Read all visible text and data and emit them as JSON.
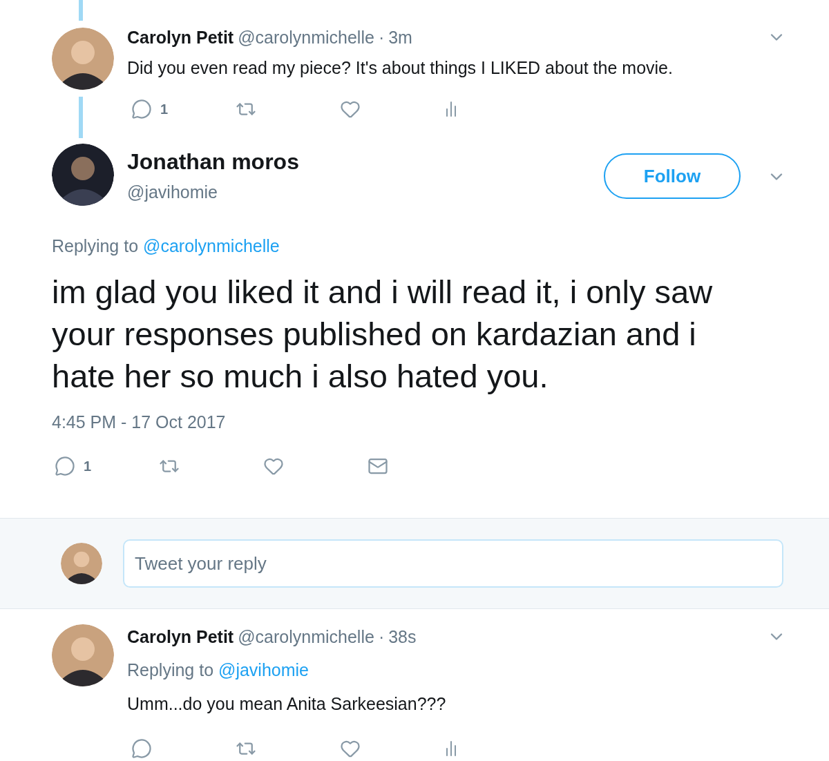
{
  "thread_tweet": {
    "name": "Carolyn Petit",
    "handle": "@carolynmichelle",
    "dot": "·",
    "time": "3m",
    "text": "Did you even read my piece? It's about things I LIKED about the movie.",
    "actions": [
      {
        "kind": "reply",
        "count": "1"
      },
      {
        "kind": "retweet"
      },
      {
        "kind": "like"
      },
      {
        "kind": "analytics"
      }
    ]
  },
  "main_tweet": {
    "name": "Jonathan moros",
    "handle": "@javihomie",
    "follow_button": "Follow",
    "replying_label": "Replying to",
    "replying_to": "@carolynmichelle",
    "text": "im glad you liked it and i will read it, i only saw your responses published on kardazian and i hate her so much i also hated you.",
    "timestamp": "4:45 PM - 17 Oct 2017",
    "actions": [
      {
        "kind": "reply",
        "count": "1"
      },
      {
        "kind": "retweet"
      },
      {
        "kind": "like"
      },
      {
        "kind": "mail"
      }
    ]
  },
  "reply_box": {
    "placeholder": "Tweet your reply"
  },
  "reply_tweet": {
    "name": "Carolyn Petit",
    "handle": "@carolynmichelle",
    "dot": "·",
    "time": "38s",
    "replying_label": "Replying to",
    "replying_to": "@javihomie",
    "text": "Umm...do you mean Anita Sarkeesian???",
    "actions": [
      {
        "kind": "reply"
      },
      {
        "kind": "retweet"
      },
      {
        "kind": "like"
      },
      {
        "kind": "analytics"
      }
    ]
  }
}
